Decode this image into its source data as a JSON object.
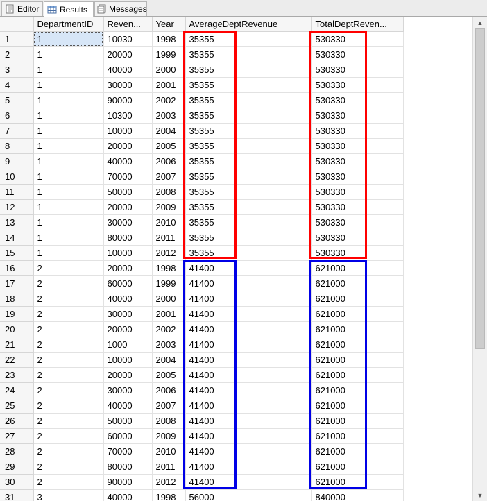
{
  "tabs": [
    {
      "label": "Editor",
      "icon": "editor-icon"
    },
    {
      "label": "Results",
      "icon": "grid-icon"
    },
    {
      "label": "Messages",
      "icon": "messages-icon"
    }
  ],
  "active_tab": "Results",
  "grid": {
    "columns": [
      "DepartmentID",
      "Reven...",
      "Year",
      "AverageDeptRevenue",
      "TotalDeptReven..."
    ],
    "rows": [
      [
        "1",
        "1",
        "10030",
        "1998",
        "35355",
        "530330"
      ],
      [
        "2",
        "1",
        "20000",
        "1999",
        "35355",
        "530330"
      ],
      [
        "3",
        "1",
        "40000",
        "2000",
        "35355",
        "530330"
      ],
      [
        "4",
        "1",
        "30000",
        "2001",
        "35355",
        "530330"
      ],
      [
        "5",
        "1",
        "90000",
        "2002",
        "35355",
        "530330"
      ],
      [
        "6",
        "1",
        "10300",
        "2003",
        "35355",
        "530330"
      ],
      [
        "7",
        "1",
        "10000",
        "2004",
        "35355",
        "530330"
      ],
      [
        "8",
        "1",
        "20000",
        "2005",
        "35355",
        "530330"
      ],
      [
        "9",
        "1",
        "40000",
        "2006",
        "35355",
        "530330"
      ],
      [
        "10",
        "1",
        "70000",
        "2007",
        "35355",
        "530330"
      ],
      [
        "11",
        "1",
        "50000",
        "2008",
        "35355",
        "530330"
      ],
      [
        "12",
        "1",
        "20000",
        "2009",
        "35355",
        "530330"
      ],
      [
        "13",
        "1",
        "30000",
        "2010",
        "35355",
        "530330"
      ],
      [
        "14",
        "1",
        "80000",
        "2011",
        "35355",
        "530330"
      ],
      [
        "15",
        "1",
        "10000",
        "2012",
        "35355",
        "530330"
      ],
      [
        "16",
        "2",
        "20000",
        "1998",
        "41400",
        "621000"
      ],
      [
        "17",
        "2",
        "60000",
        "1999",
        "41400",
        "621000"
      ],
      [
        "18",
        "2",
        "40000",
        "2000",
        "41400",
        "621000"
      ],
      [
        "19",
        "2",
        "30000",
        "2001",
        "41400",
        "621000"
      ],
      [
        "20",
        "2",
        "20000",
        "2002",
        "41400",
        "621000"
      ],
      [
        "21",
        "2",
        "1000",
        "2003",
        "41400",
        "621000"
      ],
      [
        "22",
        "2",
        "10000",
        "2004",
        "41400",
        "621000"
      ],
      [
        "23",
        "2",
        "20000",
        "2005",
        "41400",
        "621000"
      ],
      [
        "24",
        "2",
        "30000",
        "2006",
        "41400",
        "621000"
      ],
      [
        "25",
        "2",
        "40000",
        "2007",
        "41400",
        "621000"
      ],
      [
        "26",
        "2",
        "50000",
        "2008",
        "41400",
        "621000"
      ],
      [
        "27",
        "2",
        "60000",
        "2009",
        "41400",
        "621000"
      ],
      [
        "28",
        "2",
        "70000",
        "2010",
        "41400",
        "621000"
      ],
      [
        "29",
        "2",
        "80000",
        "2011",
        "41400",
        "621000"
      ],
      [
        "30",
        "2",
        "90000",
        "2012",
        "41400",
        "621000"
      ],
      [
        "31",
        "3",
        "40000",
        "1998",
        "56000",
        "840000"
      ]
    ]
  },
  "highlight_colors": {
    "dept1": "#ff0000",
    "dept2": "#0000e6"
  },
  "scrollbar": {
    "up_icon": "arrow-up-icon",
    "down_icon": "arrow-down-icon"
  }
}
